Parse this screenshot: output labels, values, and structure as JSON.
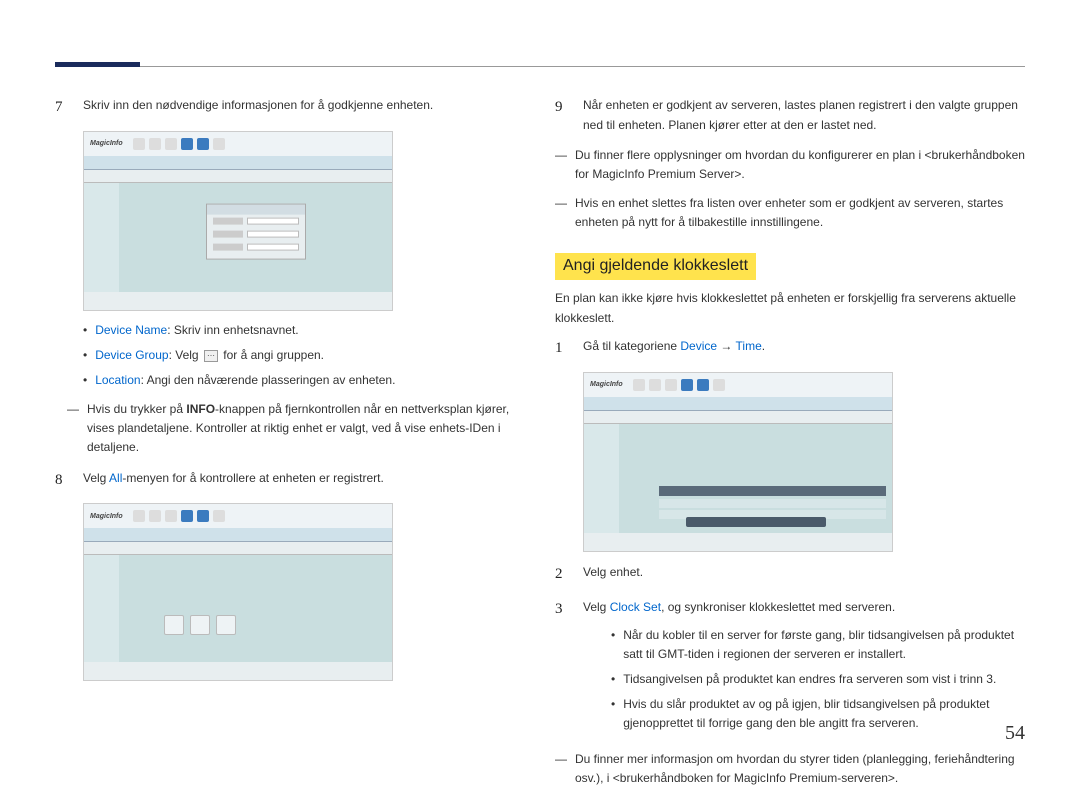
{
  "left": {
    "step7": {
      "num": "7",
      "text": "Skriv inn den nødvendige informasjonen for å godkjenne enheten."
    },
    "bullets": {
      "deviceName_k": "Device Name",
      "deviceName_t": ": Skriv inn enhetsnavnet.",
      "deviceGroup_k": "Device Group",
      "deviceGroup_t1": ": Velg ",
      "deviceGroup_t2": " for å angi gruppen.",
      "location_k": "Location",
      "location_t": ": Angi den nåværende plasseringen av enheten."
    },
    "note7": {
      "pre": "Hvis du trykker på ",
      "bold": "INFO",
      "post": "-knappen på fjernkontrollen når en nettverksplan kjører, vises plandetaljene. Kontroller at riktig enhet er valgt, ved å vise enhets-IDen i detaljene."
    },
    "step8": {
      "num": "8",
      "pre": "Velg ",
      "kw": "All",
      "post": "-menyen for å kontrollere at enheten er registrert."
    }
  },
  "right": {
    "step9": {
      "num": "9",
      "text": "Når enheten er godkjent av serveren, lastes planen registrert i den valgte gruppen ned til enheten. Planen kjører etter at den er lastet ned."
    },
    "note9a": "Du finner flere opplysninger om hvordan du konfigurerer en plan i <brukerhåndboken for MagicInfo Premium Server>.",
    "note9b": "Hvis en enhet slettes fra listen over enheter som er godkjent av serveren, startes enheten på nytt for å tilbakestille innstillingene.",
    "section_title": "Angi gjeldende klokkeslett",
    "section_desc": "En plan kan ikke kjøre hvis klokkeslettet på enheten er forskjellig fra serverens aktuelle klokkeslett.",
    "step1": {
      "num": "1",
      "pre": "Gå til kategoriene ",
      "kw1": "Device",
      "arrow": " → ",
      "kw2": "Time",
      "post": "."
    },
    "step2": {
      "num": "2",
      "text": "Velg enhet."
    },
    "step3": {
      "num": "3",
      "pre": "Velg ",
      "kw": "Clock Set",
      "post": ", og synkroniser klokkeslettet med serveren."
    },
    "subbullets": {
      "a": "Når du kobler til en server for første gang, blir tidsangivelsen på produktet satt til GMT-tiden i regionen der serveren er installert.",
      "b": "Tidsangivelsen på produktet kan endres fra serveren som vist i trinn 3.",
      "c": "Hvis du slår produktet av og på igjen, blir tidsangivelsen på produktet gjenopprettet til forrige gang den ble angitt fra serveren."
    },
    "note_end": "Du finner mer informasjon om hvordan du styrer tiden (planlegging, feriehåndtering osv.), i <brukerhåndboken for MagicInfo Premium-serveren>."
  },
  "thumb_logo": "MagicInfo",
  "page_number": "54"
}
